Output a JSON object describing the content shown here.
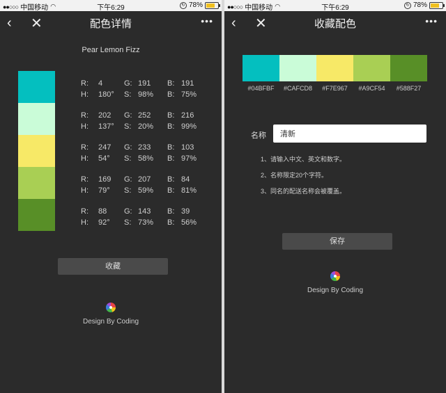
{
  "status_bar": {
    "signal": "●●○○○",
    "carrier": "中国移动",
    "wifi": "◠",
    "time": "下午6:29",
    "battery": "78%",
    "battery_level": 0.78
  },
  "left_screen": {
    "title": "配色详情",
    "palette_name": "Pear Lemon Fizz",
    "colors": [
      {
        "hex": "#04BFBF",
        "R": "4",
        "G": "191",
        "Bv": "191",
        "H": "180°",
        "S": "98%",
        "Br": "75%"
      },
      {
        "hex": "#CAFCD8",
        "R": "202",
        "G": "252",
        "Bv": "216",
        "H": "137°",
        "S": "20%",
        "Br": "99%"
      },
      {
        "hex": "#F7E967",
        "R": "247",
        "G": "233",
        "Bv": "103",
        "H": "54°",
        "S": "58%",
        "Br": "97%"
      },
      {
        "hex": "#A9CF54",
        "R": "169",
        "G": "207",
        "Bv": "84",
        "H": "79°",
        "S": "59%",
        "Br": "81%"
      },
      {
        "hex": "#588F27",
        "R": "88",
        "G": "143",
        "Bv": "39",
        "H": "92°",
        "S": "73%",
        "Br": "56%"
      }
    ],
    "labels": {
      "R": "R:",
      "G": "G:",
      "B": "B:",
      "H": "H:",
      "S": "S:"
    },
    "collect_button": "收藏",
    "credit": "Design By Coding"
  },
  "right_screen": {
    "title": "收藏配色",
    "colors": [
      "#04BFBF",
      "#CAFCD8",
      "#F7E967",
      "#A9CF54",
      "#588F27"
    ],
    "name_label": "名称",
    "name_value": "清新",
    "hints": [
      "1、请输入中文、英文和数字。",
      "2、名称限定20个字符。",
      "3、同名的配送名称会被覆盖。"
    ],
    "save_button": "保存",
    "credit": "Design By Coding"
  },
  "icons": {
    "back": "chevron-left-icon",
    "close": "close-icon",
    "more": "more-icon",
    "logo": "color-wheel-icon"
  }
}
